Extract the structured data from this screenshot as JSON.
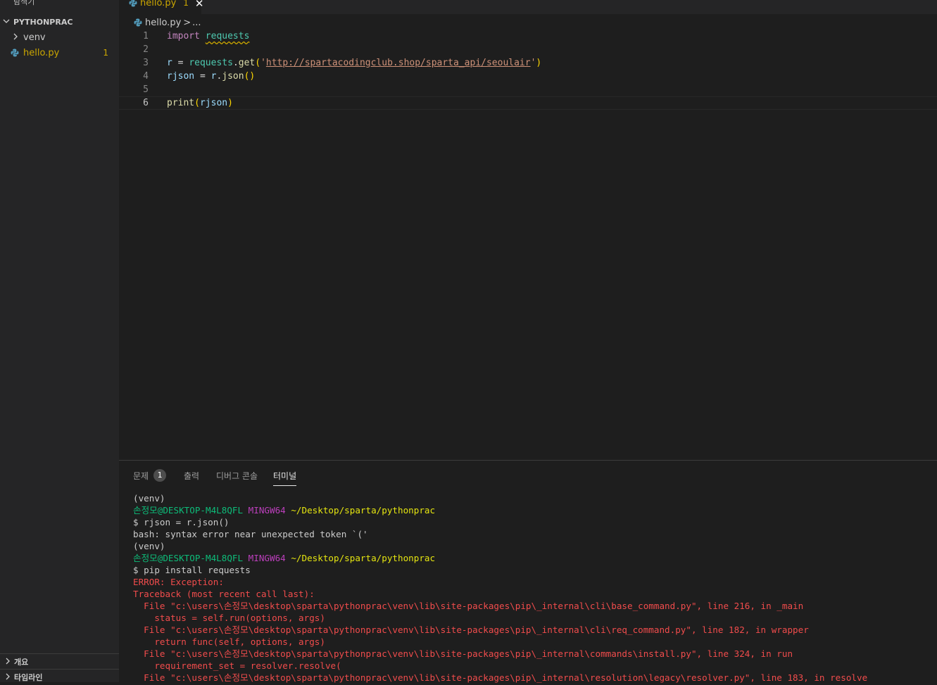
{
  "colors": {
    "accent_warning": "#cca700",
    "terminal_error": "#f14c4c",
    "terminal_green": "#0dbc79",
    "terminal_magenta": "#bc3fbc",
    "terminal_yellow": "#e5e510"
  },
  "sidebar": {
    "title": "탐색기",
    "more_icon": "ellipsis-icon",
    "folder": "PYTHONPRAC",
    "items": [
      {
        "label": "venv",
        "icon": "chevron-right-icon"
      },
      {
        "label": "hello.py",
        "icon": "python-file-icon",
        "badge": "1"
      }
    ],
    "bottom_sections": [
      "개요",
      "타임라인"
    ]
  },
  "editor": {
    "tab": {
      "label": "hello.py",
      "modified_badge": "1",
      "close_glyph": "✕"
    },
    "breadcrumb": {
      "file": "hello.py",
      "separator": ">",
      "more": "..."
    },
    "lines": [
      {
        "num": "1",
        "text": "import requests"
      },
      {
        "num": "2",
        "text": ""
      },
      {
        "num": "3",
        "text": "r = requests.get('http://spartacodingclub.shop/sparta_api/seoulair')"
      },
      {
        "num": "4",
        "text": "rjson = r.json()"
      },
      {
        "num": "5",
        "text": ""
      },
      {
        "num": "6",
        "text": "print(rjson)"
      }
    ]
  },
  "panel": {
    "tabs": [
      {
        "label": "문제",
        "badge": "1"
      },
      {
        "label": "출력"
      },
      {
        "label": "디버그 콘솔"
      },
      {
        "label": "터미널",
        "active": true
      }
    ],
    "terminal": {
      "venv": "(venv)",
      "user": "손정모@DESKTOP-M4L8QFL",
      "shell": "MINGW64",
      "path": "~/Desktop/sparta/pythonprac",
      "cmd1": "$ rjson = r.json()",
      "err1": "bash: syntax error near unexpected token `('",
      "cmd2": "$ pip install requests",
      "error_lines": [
        "ERROR: Exception:",
        "Traceback (most recent call last):",
        "  File \"c:\\users\\손정모\\desktop\\sparta\\pythonprac\\venv\\lib\\site-packages\\pip\\_internal\\cli\\base_command.py\", line 216, in _main",
        "    status = self.run(options, args)",
        "  File \"c:\\users\\손정모\\desktop\\sparta\\pythonprac\\venv\\lib\\site-packages\\pip\\_internal\\cli\\req_command.py\", line 182, in wrapper",
        "    return func(self, options, args)",
        "  File \"c:\\users\\손정모\\desktop\\sparta\\pythonprac\\venv\\lib\\site-packages\\pip\\_internal\\commands\\install.py\", line 324, in run",
        "    requirement_set = resolver.resolve(",
        "  File \"c:\\users\\손정모\\desktop\\sparta\\pythonprac\\venv\\lib\\site-packages\\pip\\_internal\\resolution\\legacy\\resolver.py\", line 183, in resolve"
      ]
    }
  }
}
